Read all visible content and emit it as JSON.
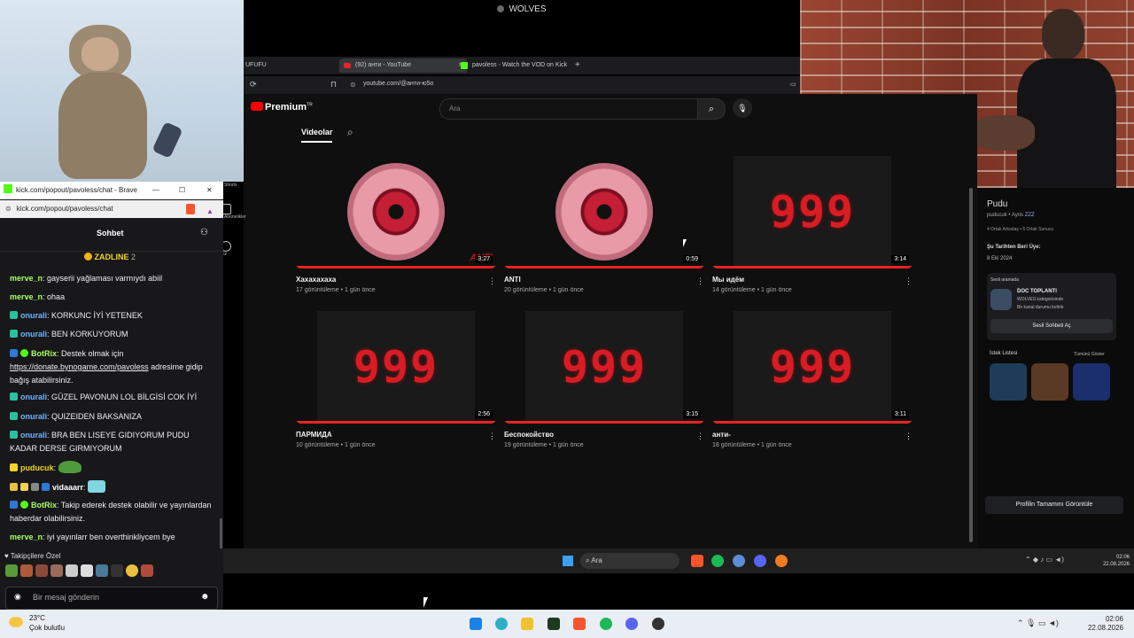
{
  "top_title": "WOLVES",
  "browser": {
    "tabs": [
      {
        "label": "UFUFU"
      },
      {
        "label": "(92) анти - YouTube"
      },
      {
        "label": "pavoless - Watch the VOD on Kick"
      }
    ],
    "new_tab": "+",
    "url": "youtube.com/@анти-ю5о"
  },
  "youtube": {
    "logo": "Premium",
    "logo_sup": "TR",
    "search_placeholder": "Ara",
    "tab_videos": "Videolar",
    "sidebar_shorts": "Shorts",
    "sidebar_subs": "Abonelikler",
    "sidebar_you": "Siz",
    "videos": [
      {
        "title": "Хахахахаха",
        "meta": "17 görüntüleme • 1 gün önce",
        "duration": "3:27",
        "thumb": "eye"
      },
      {
        "title": "ANTI",
        "meta": "20 görüntüleme • 1 gün önce",
        "duration": "0:59",
        "thumb": "eye"
      },
      {
        "title": "Мы идём",
        "meta": "14 görüntüleme • 1 gün önce",
        "duration": "3:14",
        "thumb": "999"
      },
      {
        "title": "ПАРМИДА",
        "meta": "10 görüntüleme • 1 gün önce",
        "duration": "2:56",
        "thumb": "999"
      },
      {
        "title": "Беспокойство",
        "meta": "19 görüntüleme • 1 gün önce",
        "duration": "3:15",
        "thumb": "999"
      },
      {
        "title": "анти-",
        "meta": "18 görüntüleme • 1 gün önce",
        "duration": "3:11",
        "thumb": "999"
      }
    ],
    "thumb_text": "999",
    "thumb_tag": "ANTI"
  },
  "chat": {
    "window_title": "kick.com/popout/pavoless/chat - Brave",
    "url": "kick.com/popout/pavoless/chat",
    "header": "Sohbet",
    "pinned_user": "ZADLINE",
    "pinned_count": "2",
    "messages": [
      {
        "user": "merve_n",
        "text": "gayserii yağlaması varmıydı abiil",
        "color": "green"
      },
      {
        "user": "merve_n",
        "text": "ohaa",
        "color": "green"
      },
      {
        "user": "onurali",
        "text": "KORKUNC İYİ YETENEK",
        "color": "blue"
      },
      {
        "user": "onurali",
        "text": "BEN KORKUYORUM",
        "color": "blue"
      },
      {
        "user": "BotRix",
        "text": "Destek olmak için",
        "link": "https://donate.bynogame.com/pavoless",
        "text2": "adresime gidip bağış atabilirsiniz.",
        "color": "green"
      },
      {
        "user": "onurali",
        "text": "GÜZEL PAVONUN LOL BİLGİSİ COK İYİ",
        "color": "blue"
      },
      {
        "user": "onurali",
        "text": "QUIZEIDEN BAKSANIZA",
        "color": "blue"
      },
      {
        "user": "onurali",
        "text": "BRA BEN LISEYE GIDIYORUM PUDU KADAR DERSE GIRMIYORUM",
        "color": "blue"
      },
      {
        "user": "puducuk",
        "text": "",
        "color": "yellow"
      },
      {
        "user": "vidaaarr",
        "text": "",
        "color": "white"
      },
      {
        "user": "BotRix",
        "text": "Takip ederek destek olabilir ve yayınlardan haberdar olabilirsiniz.",
        "color": "green"
      },
      {
        "user": "merve_n",
        "text": "iyi yayınlarr ben overthinkliycem bye",
        "color": "green"
      }
    ],
    "followers_only": "Takipçilere Özel",
    "input_placeholder": "Bir mesaj gönderin"
  },
  "discord": {
    "name": "Pudu",
    "handle": "puducuk",
    "status": "Ayris",
    "status_tag": "ZZZ",
    "mutual": "4 Ortak Arkadaş • 5 Ortak Sunucu",
    "member_since_label": "Şu Tarihten Beri Üye:",
    "member_since": "8 Eki 2024",
    "voice_label": "Sesli aramada",
    "voice_channel": "DOC TOPLANTI",
    "voice_server": "WOLVES kategorisinde",
    "voice_status": "Bir kanal durumu belirle",
    "voice_button": "Sesli Sohbeti Aç",
    "wishlist_label": "İstek Listesi",
    "wishlist_all": "Tümünü Göster",
    "profile_button": "Profilin Tamamını Görüntüle"
  },
  "taskbar_inner": {
    "search": "Ara",
    "time": "02:06",
    "date": "22.08.2026"
  },
  "taskbar_outer": {
    "temp": "23°C",
    "weather": "Çok bulutlu",
    "time": "02:06",
    "date": "22.08.2026"
  }
}
